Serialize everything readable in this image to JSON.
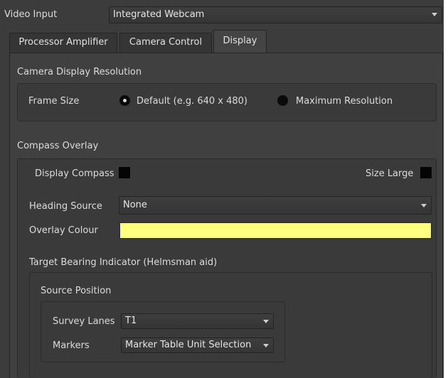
{
  "header": {
    "label": "Video Input",
    "device_value": "Integrated Webcam"
  },
  "tabs": [
    {
      "label": "Processor Amplifier"
    },
    {
      "label": "Camera Control"
    },
    {
      "label": "Display",
      "active": true
    }
  ],
  "resolution_section": {
    "title": "Camera Display Resolution",
    "frame_size_label": "Frame Size",
    "option_default": "Default (e.g. 640 x 480)",
    "option_maximum": "Maximum Resolution",
    "selected": "option_default"
  },
  "compass_section": {
    "title": "Compass Overlay",
    "display_compass_label": "Display Compass",
    "display_compass_checked": false,
    "size_large_label": "Size Large",
    "size_large_checked": false,
    "heading_source_label": "Heading Source",
    "heading_source_value": "None",
    "overlay_colour_label": "Overlay Colour",
    "overlay_colour": "#ffff80"
  },
  "target_bearing": {
    "title": "Target Bearing Indicator (Helmsman aid)",
    "source_position_title": "Source Position",
    "survey_lanes_label": "Survey Lanes",
    "survey_lanes_value": "T1",
    "markers_label": "Markers",
    "markers_value": "Marker Table Unit Selection"
  },
  "colors": {
    "background": "#3c3c3c",
    "text": "#dcdcdc",
    "overlay_swatch": "#ffff80"
  }
}
